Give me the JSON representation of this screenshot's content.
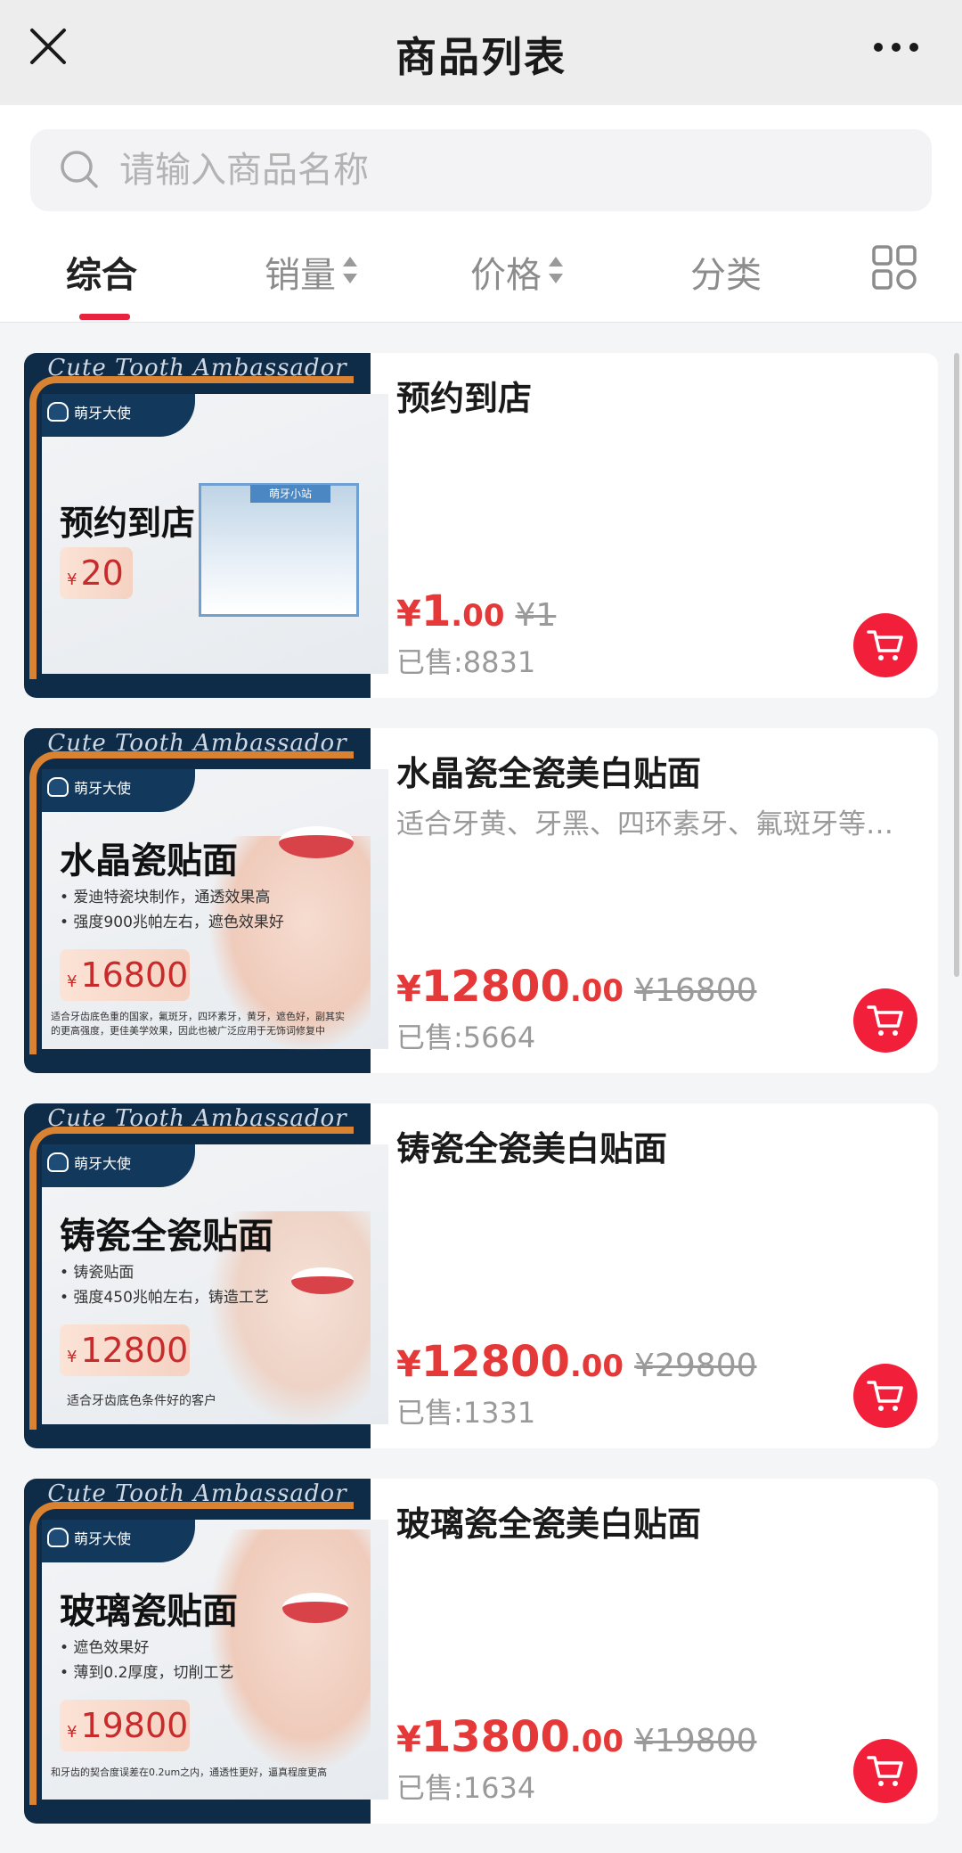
{
  "nav": {
    "title": "商品列表"
  },
  "search": {
    "placeholder": "请输入商品名称"
  },
  "tabs": [
    {
      "label": "综合",
      "active": true,
      "sortable": false
    },
    {
      "label": "销量",
      "active": false,
      "sortable": true
    },
    {
      "label": "价格",
      "active": false,
      "sortable": true
    },
    {
      "label": "分类",
      "active": false,
      "sortable": false
    }
  ],
  "colors": {
    "accent": "#e8233f",
    "price": "#e53838",
    "cart": "#f21f3a"
  },
  "thumb_common": {
    "script": "Cute Tooth Ambassador",
    "brand": "萌牙大使",
    "currency": "¥"
  },
  "products": [
    {
      "thumb_title": "预约到店",
      "thumb_bullets": [],
      "thumb_price": "20",
      "thumb_fine": "",
      "thumb_sign": "萌牙小站",
      "name": "预约到店",
      "desc": "",
      "price_currency": "¥",
      "price_int": "1",
      "price_dec": ".00",
      "orig_price": "¥1",
      "sold": "已售:8831"
    },
    {
      "thumb_title": "水晶瓷贴面",
      "thumb_bullets": [
        "• 爱迪特瓷块制作，通透效果高",
        "• 强度900兆帕左右，遮色效果好"
      ],
      "thumb_price": "16800",
      "thumb_fine": "适合牙齿底色重的国家，氟斑牙，四环素牙，黄牙，遮色好，副其实的更高强度，更佳美学效果，因此也被广泛应用于无饰词修复中",
      "thumb_sign": "",
      "name": "水晶瓷全瓷美白贴面",
      "desc": "适合牙黄、牙黑、四环素牙、氟斑牙等…",
      "price_currency": "¥",
      "price_int": "12800",
      "price_dec": ".00",
      "orig_price": "¥16800",
      "sold": "已售:5664"
    },
    {
      "thumb_title": "铸瓷全瓷贴面",
      "thumb_bullets": [
        "• 铸瓷贴面",
        "• 强度450兆帕左右，铸造工艺"
      ],
      "thumb_price": "12800",
      "thumb_fine": "适合牙齿底色条件好的客户",
      "thumb_sign": "",
      "name": "铸瓷全瓷美白贴面",
      "desc": "",
      "price_currency": "¥",
      "price_int": "12800",
      "price_dec": ".00",
      "orig_price": "¥29800",
      "sold": "已售:1331"
    },
    {
      "thumb_title": "玻璃瓷贴面",
      "thumb_bullets": [
        "• 遮色效果好",
        "• 薄到0.2厚度，切削工艺"
      ],
      "thumb_price": "19800",
      "thumb_fine": "和牙齿的契合度误差在0.2um之内，通透性更好，逼真程度更高",
      "thumb_sign": "",
      "name": "玻璃瓷全瓷美白贴面",
      "desc": "",
      "price_currency": "¥",
      "price_int": "13800",
      "price_dec": ".00",
      "orig_price": "¥19800",
      "sold": "已售:1634"
    }
  ]
}
